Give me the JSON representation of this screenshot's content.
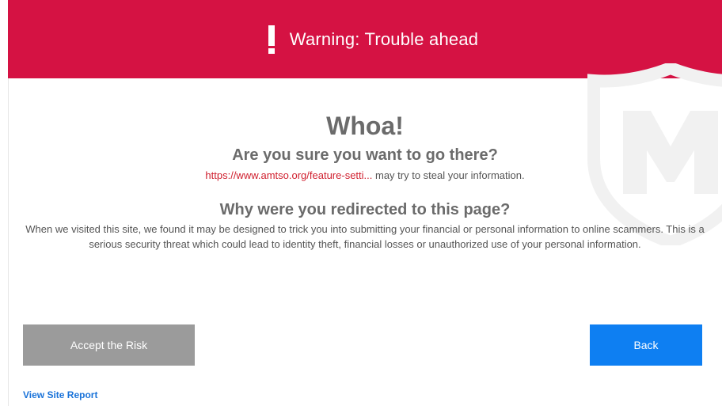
{
  "banner": {
    "icon": "exclamation-icon",
    "title": "Warning: Trouble ahead",
    "background_color": "#d51243"
  },
  "watermark": {
    "icon": "mcafee-shield-logo"
  },
  "main": {
    "headline": "Whoa!",
    "question": "Are you sure you want to go there?",
    "url": "https://www.amtso.org/feature-setti...",
    "url_suffix": " may try to steal your information.",
    "why_heading": "Why were you redirected to this page?",
    "explanation": "When we visited this site, we found it may be designed to trick you into submitting your financial or personal information to online scammers. This is a serious security threat which could lead to identity theft, financial losses or unauthorized use of your personal information."
  },
  "actions": {
    "accept_label": "Accept the Risk",
    "back_label": "Back",
    "site_report_label": "View Site Report"
  },
  "colors": {
    "accept_button": "#9b9b9b",
    "back_button": "#0e7ff2",
    "link": "#1a73d9",
    "url": "#d0202f"
  }
}
